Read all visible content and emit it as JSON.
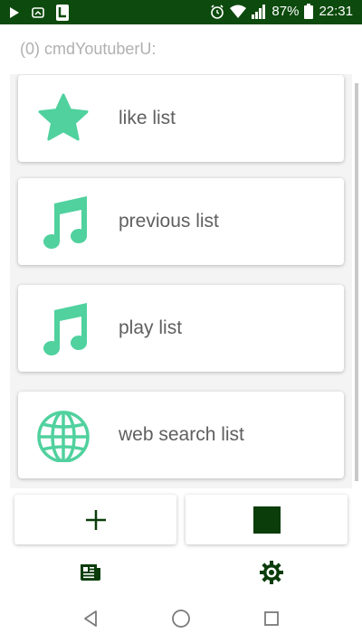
{
  "status_bar": {
    "battery": "87%",
    "time": "22:31",
    "icons": [
      "play-icon",
      "cast-icon",
      "notification-app-icon",
      "alarm-icon",
      "wifi-icon",
      "signal-icon",
      "battery-icon"
    ]
  },
  "header": {
    "title": "(0) cmdYoutuberU:"
  },
  "lists": [
    {
      "label": "like list",
      "icon": "star-icon"
    },
    {
      "label": "previous list",
      "icon": "music-note-icon"
    },
    {
      "label": "play list",
      "icon": "music-note-icon"
    },
    {
      "label": "web search list",
      "icon": "globe-icon"
    }
  ],
  "actions": {
    "add": "add-icon",
    "stop": "stop-icon"
  },
  "bottom_nav": [
    "news-icon",
    "settings-icon"
  ],
  "colors": {
    "accent": "#50d19e",
    "statusbar": "#0d4a0d",
    "dark_green": "#0b3d0b"
  }
}
